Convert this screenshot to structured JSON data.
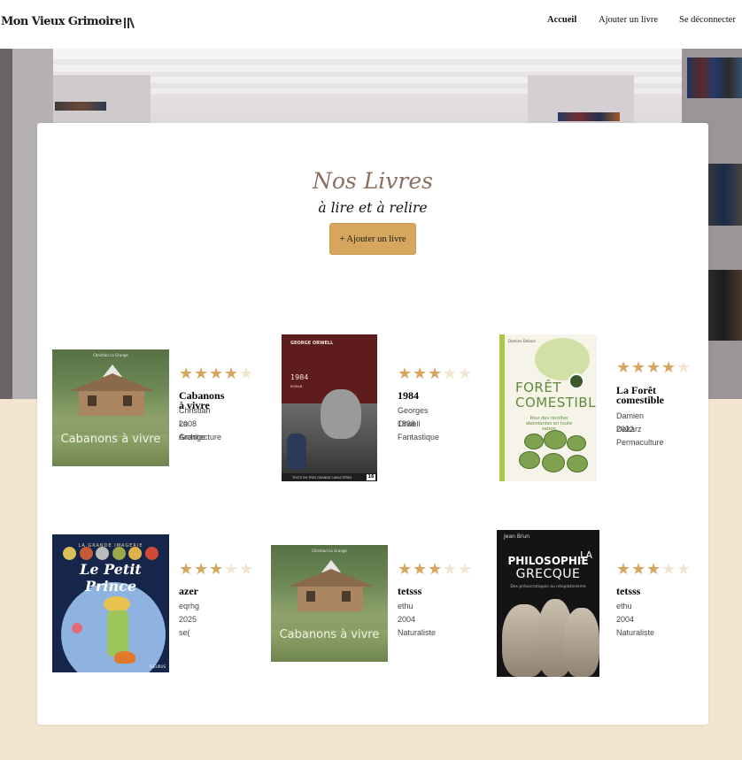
{
  "header": {
    "logo_text": "Mon Vieux Grimoire",
    "nav": {
      "home": "Accueil",
      "add_book": "Ajouter un livre",
      "logout": "Se déconnecter"
    }
  },
  "main": {
    "title": "Nos Livres",
    "subtitle": "à lire et à relire",
    "add_button": "+ Ajouter un livre"
  },
  "books": [
    {
      "title": "Cabanons à vivre",
      "author": "Christian La Grange",
      "year": "2008",
      "genre": "Architecture",
      "rating": 4,
      "cover_text": "Cabanons à vivre",
      "cover_author": "Christian La Grange"
    },
    {
      "title": "1984",
      "author": "Georges Orwell",
      "year": "1898",
      "genre": "Fantastique",
      "rating": 3,
      "cover_author": "GEORGE ORWELL",
      "cover_title": "1984",
      "cover_sub": "ROMAN",
      "cover_badge": "16",
      "cover_strip": "TEXTE EN TRÈS GRANDS CARACTÈRES"
    },
    {
      "title": "La Forêt comestible",
      "author": "Damien Dekarz",
      "year": "2022",
      "genre": "Permaculture",
      "rating": 4,
      "cover_author": "Damien Dekarz",
      "cover_title_1": "FORÊT",
      "cover_title_2": "COMESTIBLE",
      "cover_sub": "Pour des récoltes abondantes en toute saison"
    },
    {
      "title": "azer",
      "author": "eqrhg",
      "year": "2025",
      "genre": "se(",
      "rating": 3,
      "cover_head": "LA GRANDE IMAGERIE",
      "cover_title": "Le Petit Prince",
      "cover_brand": "FLEURUS"
    },
    {
      "title": "tetsss",
      "author": "ethu",
      "year": "2004",
      "genre": "Naturaliste",
      "rating": 3,
      "cover_text": "Cabanons à vivre",
      "cover_author": "Christian La Grange"
    },
    {
      "title": "tetsss",
      "author": "ethu",
      "year": "2004",
      "genre": "Naturaliste",
      "rating": 3,
      "cover_author": "Jean Brun",
      "cover_la": "LA",
      "cover_t1": "PHILOSOPHIE",
      "cover_t2": "GRECQUE",
      "cover_sub": "Des présocratiques au néoplatonisme"
    }
  ],
  "colors": {
    "accent": "#d6a65e",
    "title": "#8a6f60",
    "page_bg": "#f3e5d1",
    "star_off": "#f3e5d1"
  }
}
